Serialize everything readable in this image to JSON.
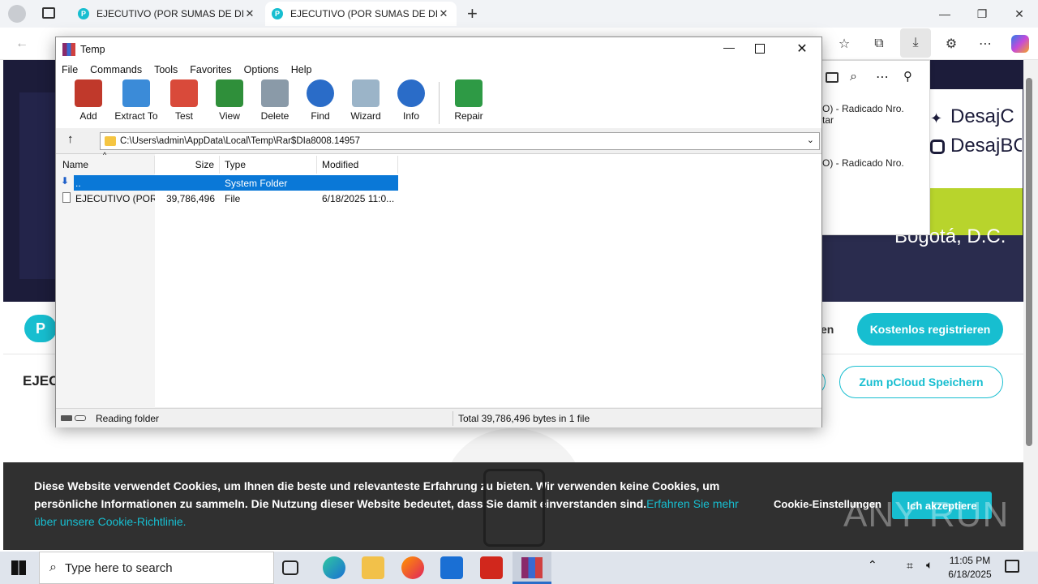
{
  "browser": {
    "tabs": [
      {
        "title": "EJECUTIVO (POR SUMAS DE DINE",
        "favicon": "P"
      },
      {
        "title": "EJECUTIVO (POR SUMAS DE DINE",
        "favicon": "P"
      }
    ]
  },
  "page": {
    "banner_texts": [
      "DesajC",
      "DesajBC",
      "Bogotá, D.C."
    ],
    "register_button": "Kostenlos registrieren",
    "save_button": "Zum pCloud Speichern",
    "partial_title": "EJEC",
    "partial_login": "en",
    "cookie": {
      "text": "Diese Website verwendet Cookies, um Ihnen die beste und relevanteste Erfahrung zu bieten. Wir verwenden keine Cookies, um persönliche Informationen zu sammeln. Die Nutzung dieser Website bedeutet, dass Sie damit einverstanden sind.",
      "link": "Erfahren Sie mehr über unsere Cookie-Richtlinie.",
      "settings": "Cookie-Einstellungen",
      "accept": "Ich akzeptiere"
    },
    "watermark": "ANY RUN"
  },
  "downloads": {
    "items": [
      {
        "line1": "O) - Radicado Nro.",
        "line2": "tar"
      },
      {
        "line1": "O) - Radicado Nro.",
        "line2": ""
      }
    ]
  },
  "winrar": {
    "title": "Temp",
    "menu": [
      "File",
      "Commands",
      "Tools",
      "Favorites",
      "Options",
      "Help"
    ],
    "tools": [
      {
        "label": "Add",
        "color": "#c0392b"
      },
      {
        "label": "Extract To",
        "color": "#3b8bd8"
      },
      {
        "label": "Test",
        "color": "#d94a3a"
      },
      {
        "label": "View",
        "color": "#2f8f3a"
      },
      {
        "label": "Delete",
        "color": "#8a9aa8"
      },
      {
        "label": "Find",
        "color": "#2a6cc8"
      },
      {
        "label": "Wizard",
        "color": "#9bb4c8"
      },
      {
        "label": "Info",
        "color": "#2a6cc8"
      },
      {
        "label": "Repair",
        "color": "#2e9a45"
      }
    ],
    "path": "C:\\Users\\admin\\AppData\\Local\\Temp\\Rar$DIa8008.14957",
    "columns": [
      "Name",
      "Size",
      "Type",
      "Modified"
    ],
    "rows": [
      {
        "name": "..",
        "size": "",
        "type": "System Folder",
        "modified": ""
      },
      {
        "name": "EJECUTIVO (POR...",
        "size": "39,786,496",
        "type": "File",
        "modified": "6/18/2025 11:0..."
      }
    ],
    "status_left": "Reading folder",
    "status_right": "Total 39,786,496 bytes in 1 file"
  },
  "taskbar": {
    "search_placeholder": "Type here to search",
    "time": "11:05 PM",
    "date": "6/18/2025"
  }
}
